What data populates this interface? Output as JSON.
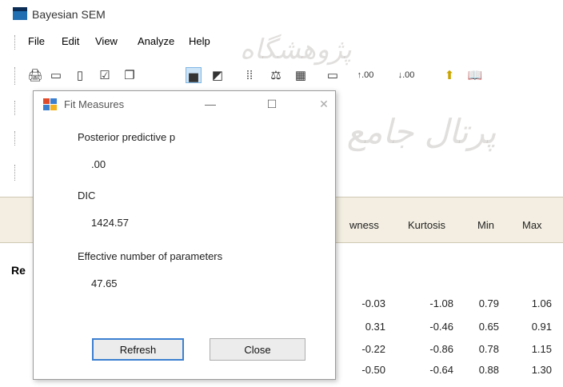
{
  "window": {
    "title": "Bayesian SEM"
  },
  "menu": [
    "File",
    "Edit",
    "View",
    "Analyze",
    "Help"
  ],
  "toolbar_icons": [
    "print-icon",
    "copy-icon",
    "document-icon",
    "check-icon",
    "pages-icon",
    "chart-icon",
    "image-icon",
    "grid-icon",
    "scale-icon",
    "table-icon",
    "text-icon",
    "increase-decimals-icon",
    "decrease-decimals-icon",
    "help-arrow-icon",
    "book-icon"
  ],
  "toolbar_labels": {
    "increase": "↑.00",
    "decrease": "↓.00"
  },
  "grid": {
    "headers": [
      "wness",
      "Kurtosis",
      "Min",
      "Max"
    ],
    "group_label": "Re",
    "rows": [
      [
        "-0.03",
        "-1.08",
        "0.79",
        "1.06"
      ],
      [
        "0.31",
        "-0.46",
        "0.65",
        "0.91"
      ],
      [
        "-0.22",
        "-0.86",
        "0.78",
        "1.15"
      ],
      [
        "-0.50",
        "-0.64",
        "0.88",
        "1.30"
      ]
    ]
  },
  "dialog": {
    "title": "Fit Measures",
    "posterior_label": "Posterior predictive p",
    "posterior_value": ".00",
    "dic_label": "DIC",
    "dic_value": "1424.57",
    "enp_label": "Effective number of parameters",
    "enp_value": "47.65",
    "refresh_label": "Refresh",
    "close_label": "Close"
  }
}
